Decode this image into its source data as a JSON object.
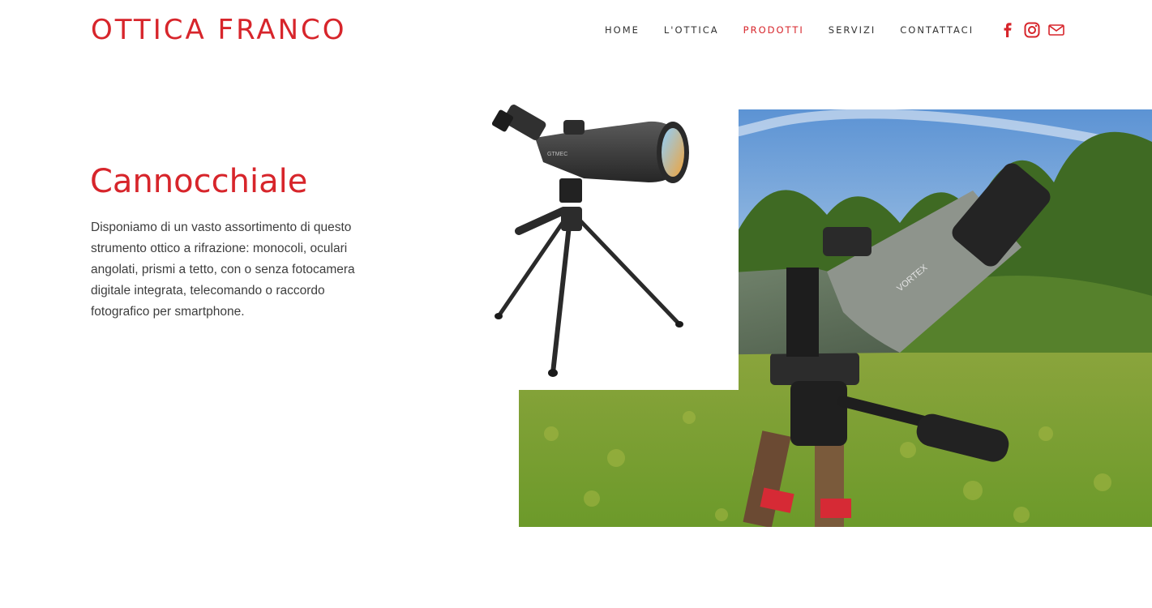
{
  "brand": {
    "name": "OTTICA FRANCO",
    "accent": "#d7252b"
  },
  "nav": {
    "items": [
      {
        "label": "HOME",
        "active": false
      },
      {
        "label": "L'OTTICA",
        "active": false
      },
      {
        "label": "PRODOTTI",
        "active": true
      },
      {
        "label": "SERVIZI",
        "active": false
      },
      {
        "label": "CONTATTACI",
        "active": false
      }
    ],
    "social_icons": [
      "facebook-icon",
      "instagram-icon",
      "mail-icon"
    ]
  },
  "product": {
    "title": "Cannocchiale",
    "description": "Disponiamo di un vasto assortimento di questo strumento ottico a rifrazione: monocoli, oculari angolati, prismi a tetto, con o senza fotocamera digitale integrata, telecomando o raccordo fotografico per smartphone."
  },
  "images": {
    "product_label": "GTMEC",
    "field_label": "VORTEX"
  }
}
